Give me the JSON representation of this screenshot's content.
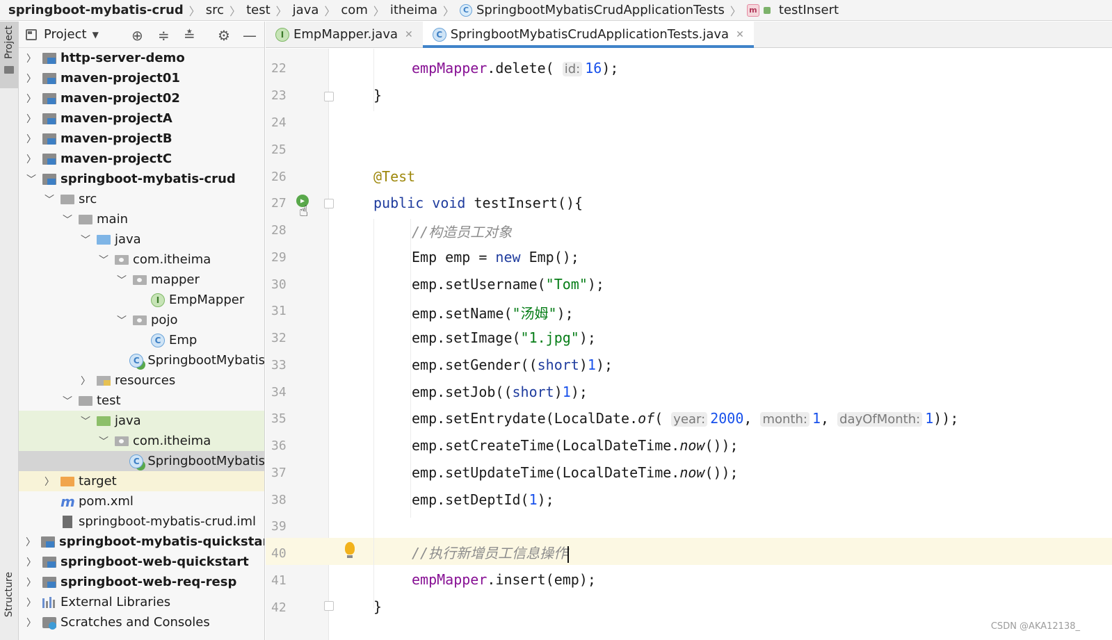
{
  "breadcrumb": {
    "items": [
      "springboot-mybatis-crud",
      "src",
      "test",
      "java",
      "com",
      "itheima",
      "SpringbootMybatisCrudApplicationTests",
      "testInsert"
    ]
  },
  "sidebar": {
    "project_tab": "Project",
    "structure_tab": "Structure"
  },
  "project_panel": {
    "title": "Project",
    "tree": [
      {
        "label": "http-server-demo"
      },
      {
        "label": "maven-project01"
      },
      {
        "label": "maven-project02"
      },
      {
        "label": "maven-projectA"
      },
      {
        "label": "maven-projectB"
      },
      {
        "label": "maven-projectC"
      },
      {
        "label": "springboot-mybatis-crud"
      },
      {
        "label": "src"
      },
      {
        "label": "main"
      },
      {
        "label": "java"
      },
      {
        "label": "com.itheima"
      },
      {
        "label": "mapper"
      },
      {
        "label": "EmpMapper"
      },
      {
        "label": "pojo"
      },
      {
        "label": "Emp"
      },
      {
        "label": "SpringbootMybatis"
      },
      {
        "label": "resources"
      },
      {
        "label": "test"
      },
      {
        "label": "java"
      },
      {
        "label": "com.itheima"
      },
      {
        "label": "SpringbootMybatis"
      },
      {
        "label": "target"
      },
      {
        "label": "pom.xml"
      },
      {
        "label": "springboot-mybatis-crud.iml"
      },
      {
        "label": "springboot-mybatis-quickstart"
      },
      {
        "label": "springboot-web-quickstart"
      },
      {
        "label": "springboot-web-req-resp"
      },
      {
        "label": "External Libraries"
      },
      {
        "label": "Scratches and Consoles"
      }
    ]
  },
  "tabs": [
    {
      "label": "EmpMapper.java",
      "icon": "I"
    },
    {
      "label": "SpringbootMybatisCrudApplicationTests.java",
      "icon": "C"
    }
  ],
  "editor": {
    "line_numbers": [
      "22",
      "23",
      "24",
      "25",
      "26",
      "27",
      "28",
      "29",
      "30",
      "31",
      "32",
      "33",
      "34",
      "35",
      "36",
      "37",
      "38",
      "39",
      "40",
      "41",
      "42"
    ],
    "tokens": {
      "l22_obj": "empMapper",
      "l22_m": ".delete(",
      "l22_hint": "id:",
      "l22_num": "16",
      "l22_end": ");",
      "l23": "}",
      "l26": "@Test",
      "l27_kw": "public void",
      "l27_rest": " testInsert(){",
      "l28": "//构造员工对象",
      "l29_a": "Emp emp = ",
      "l29_kw": "new",
      "l29_b": " Emp();",
      "l30_a": "emp.setUsername(",
      "l30_s": "\"Tom\"",
      "l30_b": ");",
      "l31_a": "emp.setName(",
      "l31_s": "\"汤姆\"",
      "l31_b": ");",
      "l32_a": "emp.setImage(",
      "l32_s": "\"1.jpg\"",
      "l32_b": ");",
      "l33_a": "emp.setGender((",
      "l33_kw": "short",
      "l33_b": ")",
      "l33_n": "1",
      "l33_c": ");",
      "l34_a": "emp.setJob((",
      "l34_kw": "short",
      "l34_b": ")",
      "l34_n": "1",
      "l34_c": ");",
      "l35_a": "emp.setEntrydate(LocalDate.",
      "l35_of": "of",
      "l35_p": "(",
      "l35_h1": "year:",
      "l35_n1": "2000",
      "l35_c1": ", ",
      "l35_h2": "month:",
      "l35_n2": "1",
      "l35_c2": ", ",
      "l35_h3": "dayOfMonth:",
      "l35_n3": "1",
      "l35_end": "));",
      "l36_a": "emp.setCreateTime(LocalDateTime.",
      "l36_now": "now",
      "l36_b": "());",
      "l37_a": "emp.setUpdateTime(LocalDateTime.",
      "l37_now": "now",
      "l37_b": "());",
      "l38_a": "emp.setDeptId(",
      "l38_n": "1",
      "l38_b": ");",
      "l40": "//执行新增员工信息操作",
      "l41_obj": "empMapper",
      "l41_rest": ".insert(emp);",
      "l42": "}"
    }
  },
  "watermark": "CSDN @AKA12138_",
  "colors": {
    "keyword": "#1f3c9e",
    "field": "#871094",
    "number": "#1750eb",
    "string": "#067d17",
    "annotation": "#9e880d",
    "comment": "#8c8c8c",
    "tab_underline": "#4083c9"
  }
}
